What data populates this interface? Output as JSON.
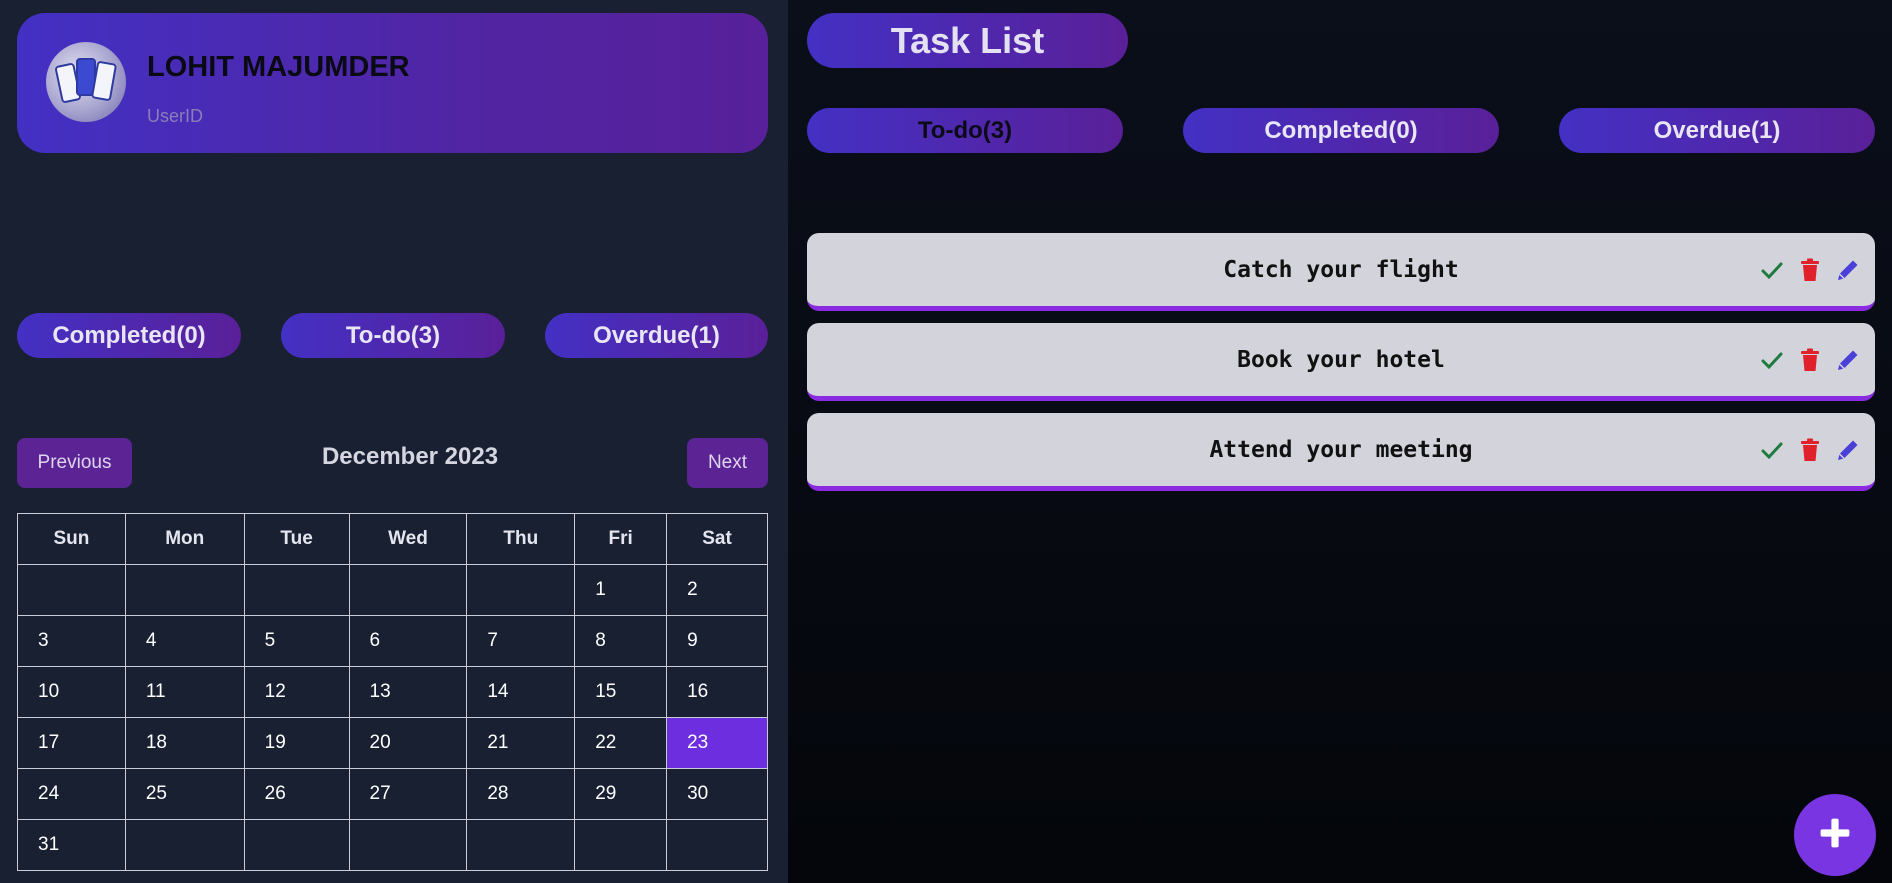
{
  "profile": {
    "name": "LOHIT MAJUMDER",
    "user_id": "UserID"
  },
  "left_stats": {
    "completed": "Completed(0)",
    "todo": "To-do(3)",
    "overdue": "Overdue(1)"
  },
  "calendar": {
    "previous_label": "Previous",
    "next_label": "Next",
    "month_label": "December 2023",
    "weekdays": [
      "Sun",
      "Mon",
      "Tue",
      "Wed",
      "Thu",
      "Fri",
      "Sat"
    ],
    "weeks": [
      [
        "",
        "",
        "",
        "",
        "",
        "1",
        "2"
      ],
      [
        "3",
        "4",
        "5",
        "6",
        "7",
        "8",
        "9"
      ],
      [
        "10",
        "11",
        "12",
        "13",
        "14",
        "15",
        "16"
      ],
      [
        "17",
        "18",
        "19",
        "20",
        "21",
        "22",
        "23"
      ],
      [
        "24",
        "25",
        "26",
        "27",
        "28",
        "29",
        "30"
      ],
      [
        "31",
        "",
        "",
        "",
        "",
        "",
        ""
      ]
    ],
    "selected_day": "23"
  },
  "task_list": {
    "title": "Task List",
    "tabs": {
      "todo": "To-do(3)",
      "completed": "Completed(0)",
      "overdue": "Overdue(1)"
    },
    "tasks": [
      {
        "text": "Catch your flight"
      },
      {
        "text": "Book your hotel"
      },
      {
        "text": "Attend your meeting"
      }
    ],
    "icons": {
      "complete": "check-icon",
      "delete": "trash-icon",
      "edit": "pencil-icon"
    }
  },
  "fab_icon": "plus-icon",
  "colors": {
    "accent": "#7a35e3",
    "gradient_start": "#4330c4",
    "gradient_end": "#5a2099",
    "check": "#1f7a3e",
    "trash": "#e0202a",
    "pencil": "#4a3fd8"
  }
}
